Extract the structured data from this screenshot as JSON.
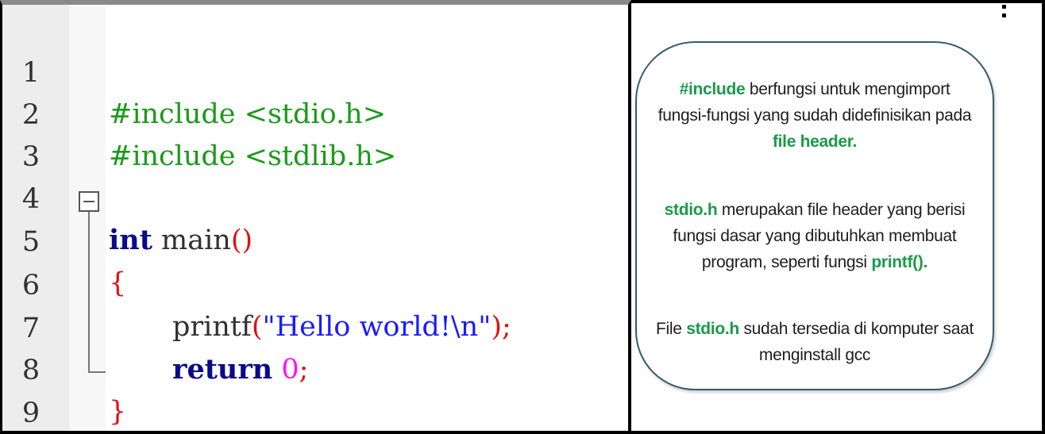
{
  "editor": {
    "lines": [
      {
        "num": "1",
        "preproc": "#include <stdio.h>"
      },
      {
        "num": "2",
        "preproc": "#include <stdlib.h>"
      },
      {
        "num": "3"
      },
      {
        "num": "4",
        "kw": "int",
        "name": " main",
        "punc": "()"
      },
      {
        "num": "5",
        "brace_open": "{"
      },
      {
        "num": "6",
        "fn": "printf",
        "lparen": "(",
        "str": "\"Hello world!\\n\"",
        "rparen_semi": ");"
      },
      {
        "num": "7",
        "kw": "return",
        "num_lit": "0",
        "semi": ";"
      },
      {
        "num": "8",
        "brace_close": "}"
      },
      {
        "num": "9"
      }
    ]
  },
  "notes": {
    "p1_a": "#include",
    "p1_b": " berfungsi untuk mengimport",
    "p1_c": "fungsi-fungsi yang sudah didefinisikan pada",
    "p1_d": "file header.",
    "p2_a": "stdio.h",
    "p2_b": " merupakan file header yang berisi",
    "p2_c": "fungsi dasar yang dibutuhkan membuat",
    "p2_d": "program, seperti fungsi ",
    "p2_e": "printf().",
    "p3_a": "File ",
    "p3_b": "stdio.h",
    "p3_c": " sudah tersedia di komputer saat",
    "p3_d": "menginstall gcc"
  },
  "colors": {
    "preprocessor": "#1a9a1a",
    "keyword": "#0a0a8a",
    "punctuation": "#e01010",
    "string": "#1a1aff",
    "number": "#ff10ff",
    "highlight": "#1a9a4a",
    "bubble_border": "#355c6e"
  },
  "icons": [
    "fold-collapse-icon",
    "more-options-icon"
  ]
}
